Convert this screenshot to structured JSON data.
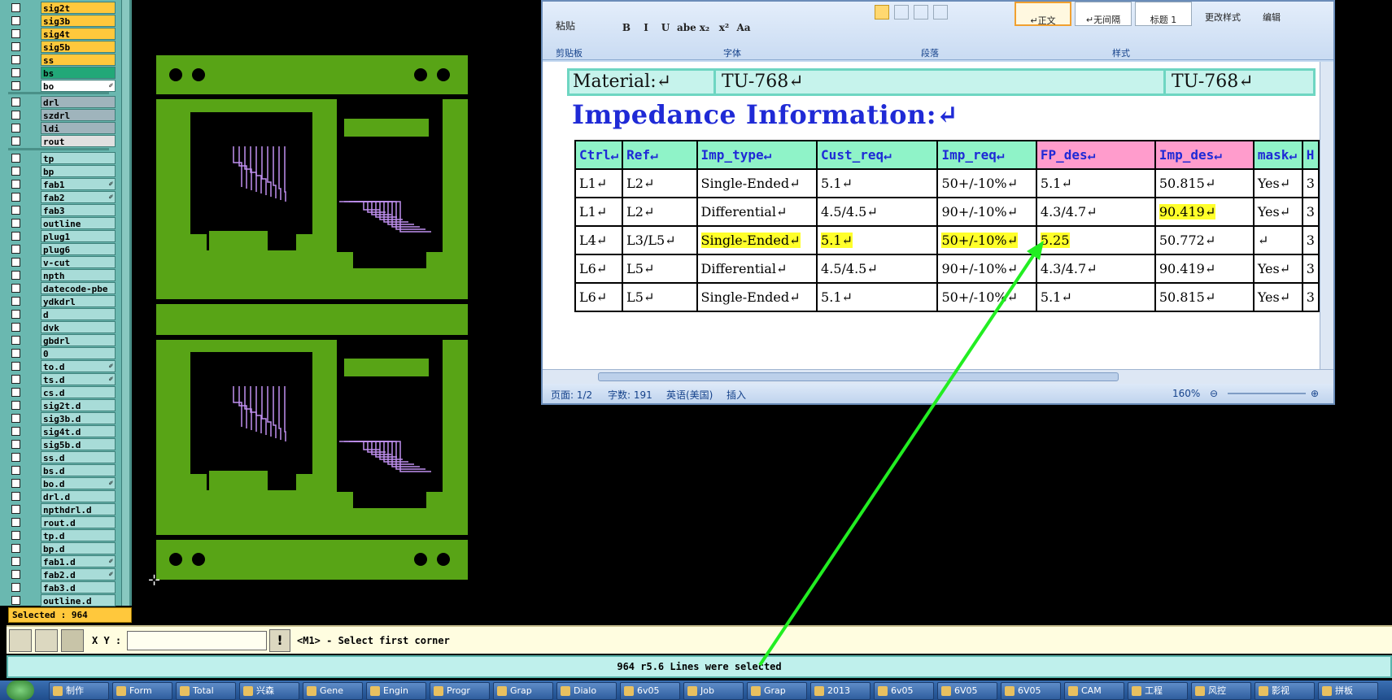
{
  "layer_panel": {
    "group1": [
      {
        "name": "sig2t",
        "color": "#ffc83c",
        "flag": ""
      },
      {
        "name": "sig3b",
        "color": "#ffc83c",
        "flag": ""
      },
      {
        "name": "sig4t",
        "color": "#ffc83c",
        "flag": ""
      },
      {
        "name": "sig5b",
        "color": "#ffc83c",
        "flag": ""
      },
      {
        "name": "ss",
        "color": "#ffc83c",
        "flag": ""
      },
      {
        "name": "bs",
        "color": "#22a878",
        "flag": ""
      },
      {
        "name": "bo",
        "color": "#ffffff",
        "flag": "✐"
      }
    ],
    "group2": [
      {
        "name": "drl",
        "color": "#9fb4bc",
        "flag": ""
      },
      {
        "name": "szdrl",
        "color": "#9fb4bc",
        "flag": ""
      },
      {
        "name": "ldi",
        "color": "#9fb4bc",
        "flag": ""
      },
      {
        "name": "rout",
        "color": "#e0e0e0",
        "flag": ""
      }
    ],
    "group3": [
      {
        "name": "tp",
        "flag": ""
      },
      {
        "name": "bp",
        "flag": ""
      },
      {
        "name": "fab1",
        "flag": "✐"
      },
      {
        "name": "fab2",
        "flag": "✐"
      },
      {
        "name": "fab3",
        "flag": ""
      },
      {
        "name": "outline",
        "flag": ""
      },
      {
        "name": "plug1",
        "flag": ""
      },
      {
        "name": "plug6",
        "flag": ""
      },
      {
        "name": "v-cut",
        "flag": ""
      },
      {
        "name": "npth",
        "flag": ""
      },
      {
        "name": "datecode-pbe",
        "flag": ""
      },
      {
        "name": "ydkdrl",
        "flag": ""
      },
      {
        "name": "d",
        "flag": ""
      },
      {
        "name": "dvk",
        "flag": ""
      },
      {
        "name": "gbdrl",
        "flag": ""
      },
      {
        "name": "0",
        "flag": ""
      },
      {
        "name": "to.d",
        "flag": "✐"
      },
      {
        "name": "ts.d",
        "flag": "✐"
      },
      {
        "name": "cs.d",
        "flag": ""
      },
      {
        "name": "sig2t.d",
        "flag": ""
      },
      {
        "name": "sig3b.d",
        "flag": ""
      },
      {
        "name": "sig4t.d",
        "flag": ""
      },
      {
        "name": "sig5b.d",
        "flag": ""
      },
      {
        "name": "ss.d",
        "flag": ""
      },
      {
        "name": "bs.d",
        "flag": ""
      },
      {
        "name": "bo.d",
        "flag": "✐"
      },
      {
        "name": "drl.d",
        "flag": ""
      },
      {
        "name": "npthdrl.d",
        "flag": ""
      },
      {
        "name": "rout.d",
        "flag": ""
      },
      {
        "name": "tp.d",
        "flag": ""
      },
      {
        "name": "bp.d",
        "flag": ""
      },
      {
        "name": "fab1.d",
        "flag": "✐"
      },
      {
        "name": "fab2.d",
        "flag": "✐"
      },
      {
        "name": "fab3.d",
        "flag": ""
      },
      {
        "name": "outline.d",
        "flag": ""
      }
    ],
    "selected_text": "Selected : 964"
  },
  "word": {
    "ribbon": {
      "paste_label": "粘贴",
      "groups": {
        "clipboard": "剪贴板",
        "font": "字体",
        "paragraph": "段落",
        "styles": "样式"
      },
      "font_buttons": [
        "B",
        "I",
        "U",
        "abe",
        "x₂",
        "x²",
        "Aa"
      ],
      "style_normal": "↵正文",
      "style_nospacing": "↵无间隔",
      "style_heading1": "标题 1",
      "change_styles": "更改样式",
      "edit": "编辑"
    },
    "document": {
      "material_label": "Material:↵",
      "material_value1": "TU-768↵",
      "material_value2": "TU-768↵",
      "section_title": "Impedance Information:↵",
      "table_headers": [
        "Ctrl↵",
        "Ref↵",
        "Imp_type↵",
        "Cust_req↵",
        "Imp_req↵",
        "FP_des↵",
        "Imp_des↵",
        "mask↵",
        "H"
      ],
      "table_rows": [
        [
          "L1↵",
          "L2↵",
          "Single-Ended↵",
          "5.1↵",
          "50+/-10%↵",
          "5.1↵",
          "50.815↵",
          "Yes↵",
          "3"
        ],
        [
          "L1↵",
          "L2↵",
          "Differential↵",
          "4.5/4.5↵",
          "90+/-10%↵",
          "4.3/4.7↵",
          "90.419↵",
          "Yes↵",
          "3"
        ],
        [
          "L4↵",
          "L3/L5↵",
          "Single-Ended↵",
          "5.1↵",
          "50+/-10%↵",
          "5.25",
          "50.772↵",
          "↵",
          "3"
        ],
        [
          "L6↵",
          "L5↵",
          "Differential↵",
          "4.5/4.5↵",
          "90+/-10%↵",
          "4.3/4.7↵",
          "90.419↵",
          "Yes↵",
          "3"
        ],
        [
          "L6↵",
          "L5↵",
          "Single-Ended↵",
          "5.1↵",
          "50+/-10%↵",
          "5.1↵",
          "50.815↵",
          "Yes↵",
          "3"
        ]
      ],
      "highlight_color": "#ffff2a",
      "header_color": "#8ff3c8",
      "header_pink": "#ff9ccc"
    },
    "status": {
      "page": "页面: 1/2",
      "words": "字数: 191",
      "language": "英语(美国)",
      "mode": "插入",
      "zoom": "160%"
    }
  },
  "command": {
    "xy_label": "X Y :",
    "xy_value": "",
    "prompt": "<M1> - Select first corner",
    "message": "964 r5.6 Lines were selected"
  },
  "taskbar": {
    "items": [
      "制作",
      "Form",
      "Total",
      "兴森",
      "Gene",
      "Engin",
      "Progr",
      "Grap",
      "Dialo",
      "6v05",
      "Job",
      "Grap",
      "2013",
      "6v05",
      "6V05",
      "6V05",
      "CAM",
      "工程",
      "风控",
      "影视",
      "拼板"
    ]
  },
  "colors": {
    "board_green": "#58a416",
    "trace_purple": "#c090f0",
    "arrow_green": "#22ee22"
  }
}
